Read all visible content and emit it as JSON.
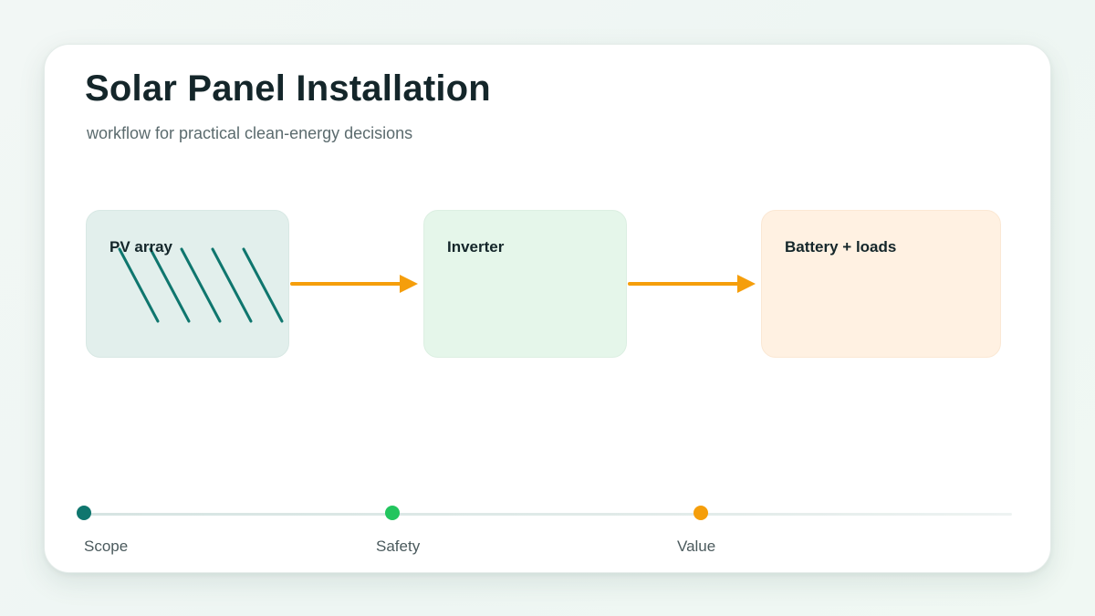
{
  "header": {
    "title": "Solar Panel Installation",
    "subtitle": "workflow for practical clean-energy decisions"
  },
  "nodes": [
    {
      "label": "PV array",
      "icon": "solar-panel-lines-icon",
      "fill": "#e2efec"
    },
    {
      "label": "Inverter",
      "fill": "#e5f6ea"
    },
    {
      "label": "Battery + loads",
      "fill": "#fff1e2"
    }
  ],
  "timeline": {
    "milestones": [
      {
        "label": "Scope",
        "color": "#0f766e"
      },
      {
        "label": "Safety",
        "color": "#22c55e"
      },
      {
        "label": "Value",
        "color": "#f59e0b"
      }
    ]
  },
  "colors": {
    "accent_teal": "#0f766e",
    "arrow": "#f59e0b",
    "text_dark": "#14262a",
    "text_muted": "#5b6b6e"
  }
}
